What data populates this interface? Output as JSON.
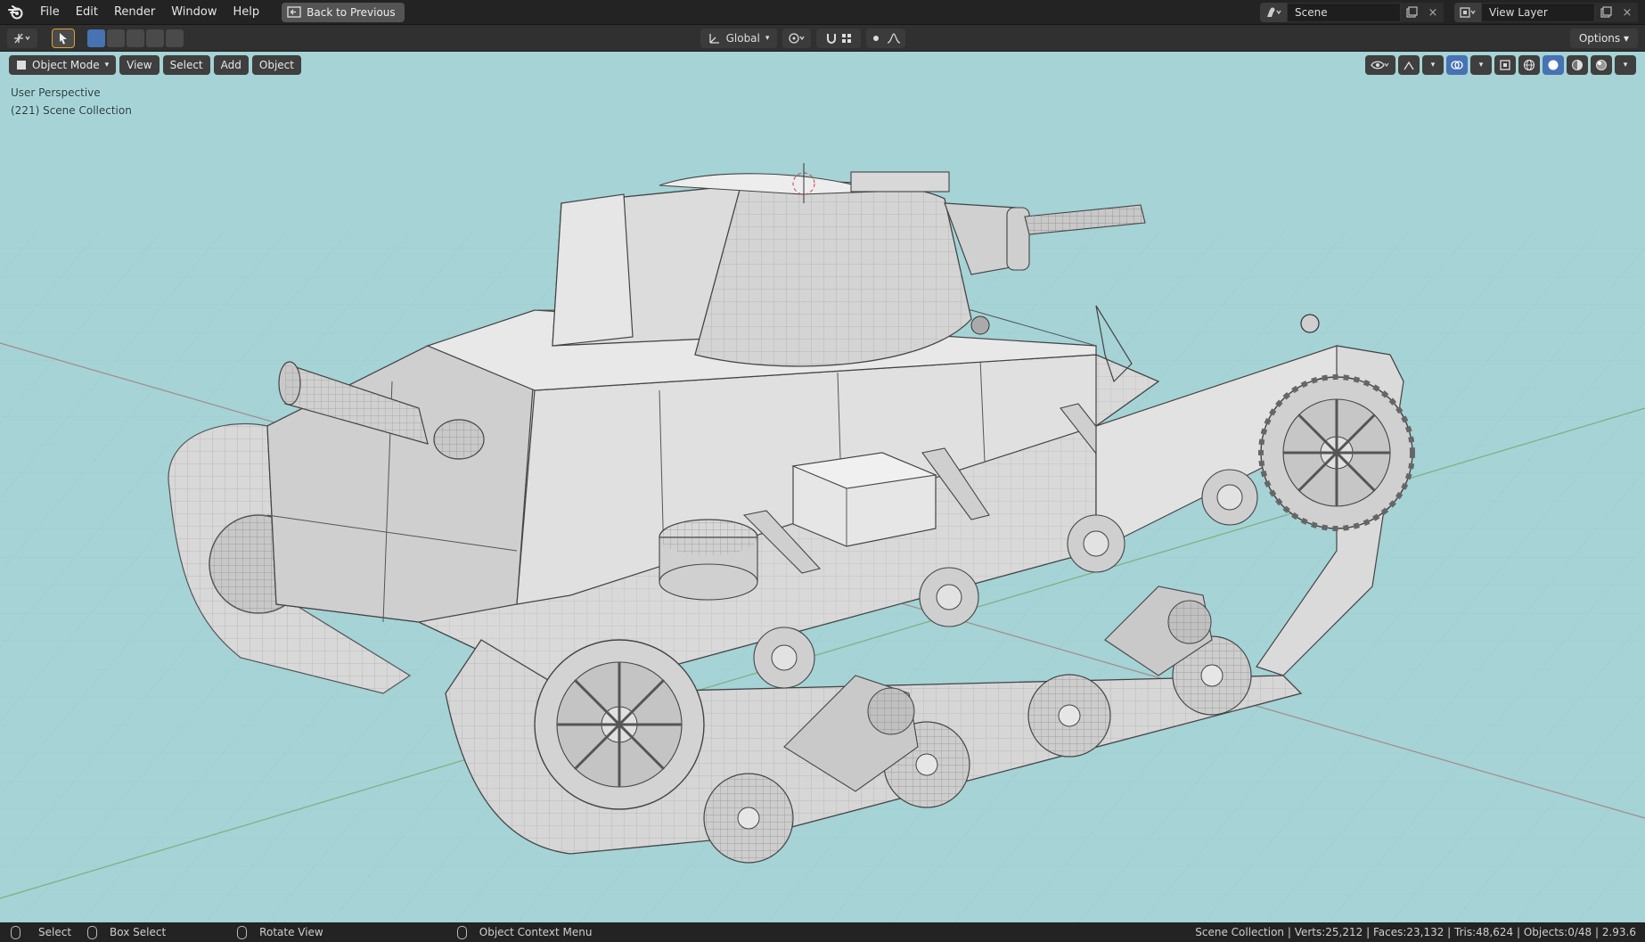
{
  "menu": {
    "items": [
      "File",
      "Edit",
      "Render",
      "Window",
      "Help"
    ],
    "back_button": "Back to Previous"
  },
  "top_right": {
    "scene_name": "Scene",
    "view_layer_name": "View Layer"
  },
  "toolbar": {
    "transform_orientation": "Global",
    "options_label": "Options"
  },
  "viewport": {
    "mode": "Object Mode",
    "menus": [
      "View",
      "Select",
      "Add",
      "Object"
    ],
    "info_line1": "User Perspective",
    "info_line2": "(221) Scene Collection",
    "background_color": "#a5d3d6"
  },
  "statusbar": {
    "select": "Select",
    "box_select": "Box Select",
    "rotate_view": "Rotate View",
    "context_menu": "Object Context Menu",
    "stats": "Scene Collection | Verts:25,212 | Faces:23,132 | Tris:48,624 | Objects:0/48 | 2.93.6"
  }
}
